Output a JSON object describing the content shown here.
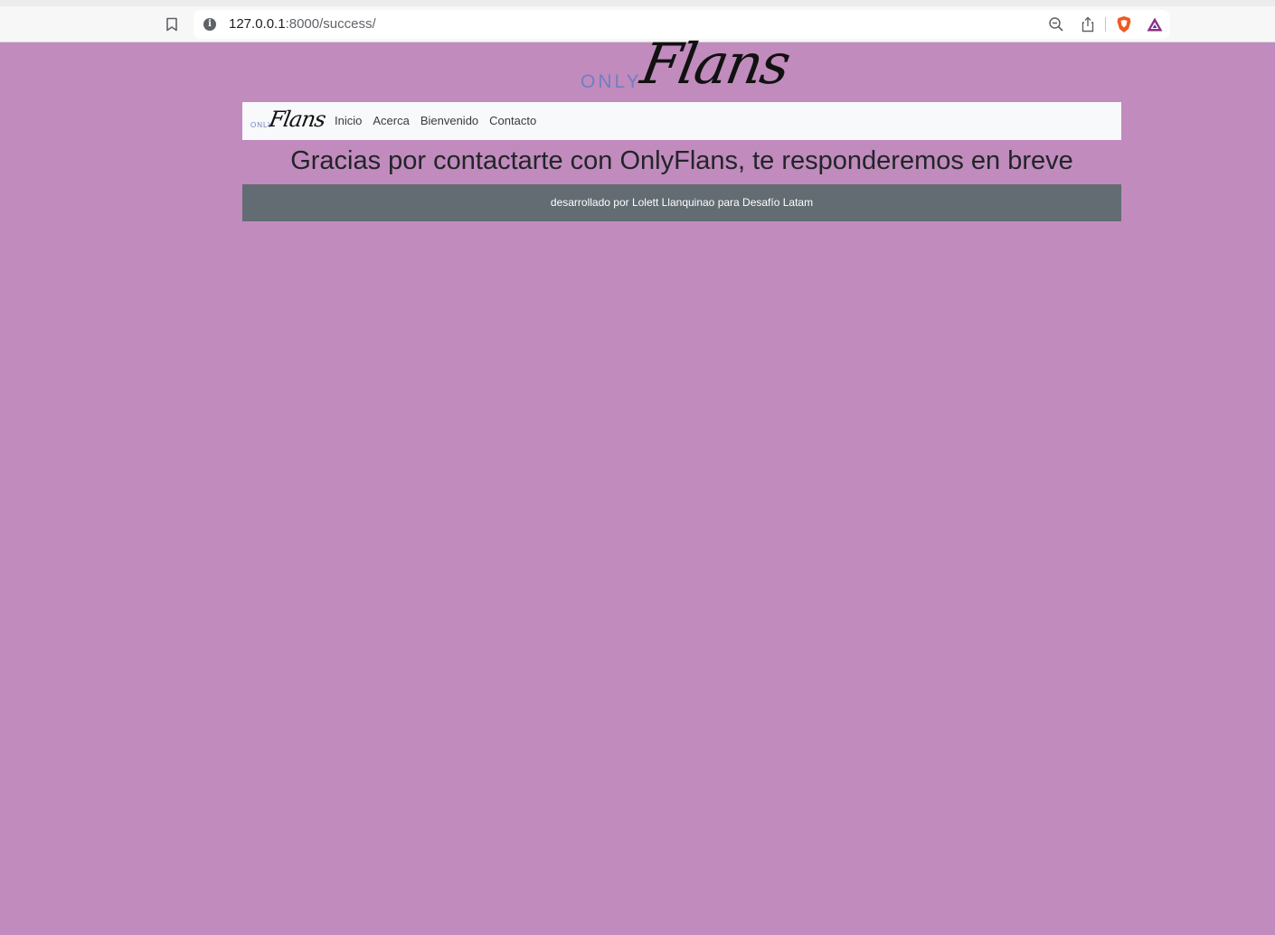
{
  "browser": {
    "url_host": "127.0.0.1",
    "url_rest": ":8000/success/",
    "icons": {
      "bookmark": "bookmark-icon",
      "info": "info-icon",
      "zoom": "zoom-out-icon",
      "share": "share-icon",
      "brave": "brave-shield-icon",
      "rewards": "brave-rewards-icon"
    },
    "info_glyph": "i"
  },
  "logo": {
    "only": "ONLY",
    "flans": "Flans"
  },
  "navbar": {
    "brand_only": "ONLY",
    "brand_flans": "Flans",
    "links": [
      "Inicio",
      "Acerca",
      "Bienvenido",
      "Contacto"
    ]
  },
  "main": {
    "heading": "Gracias por contactarte con OnlyFlans, te responderemos en breve"
  },
  "footer": {
    "text": "desarrollado por Lolett Llanquinao para Desafío Latam"
  },
  "colors": {
    "page_background": "#c18bbd",
    "navbar_background": "#f8f9fa",
    "footer_background": "#626c72",
    "logo_accent": "#6f7fc5"
  }
}
